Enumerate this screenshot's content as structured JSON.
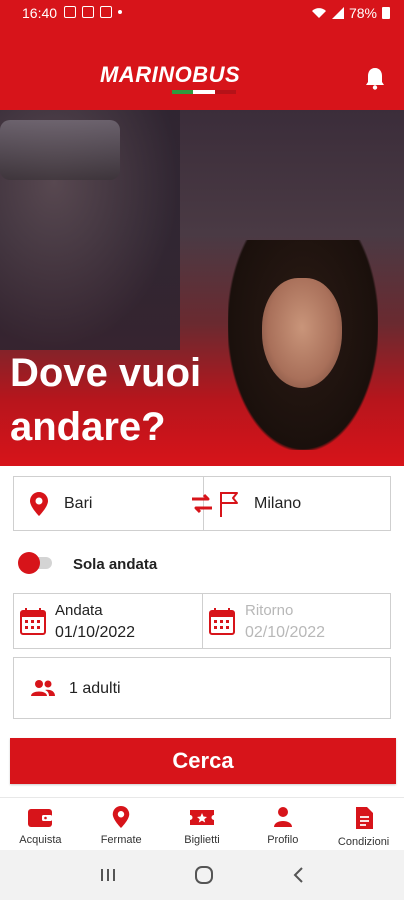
{
  "status_bar": {
    "time": "16:40",
    "battery": "78%"
  },
  "header": {
    "logo_text": "MARINOBUS",
    "brand_color": "#d7141a"
  },
  "hero": {
    "title": "Dove vuoi andare?"
  },
  "search": {
    "from": "Bari",
    "to": "Milano",
    "one_way_label": "Sola andata",
    "one_way_enabled": false,
    "departure_label": "Andata",
    "departure_date": "01/10/2022",
    "return_label": "Ritorno",
    "return_date": "02/10/2022",
    "passengers": "1 adulti",
    "submit_label": "Cerca"
  },
  "bottom_nav": {
    "items": [
      {
        "label": "Acquista",
        "icon": "wallet-icon"
      },
      {
        "label": "Fermate",
        "icon": "map-pin-icon"
      },
      {
        "label": "Biglietti",
        "icon": "ticket-icon"
      },
      {
        "label": "Profilo",
        "icon": "person-icon"
      },
      {
        "label": "Condizioni",
        "icon": "document-icon"
      }
    ]
  }
}
